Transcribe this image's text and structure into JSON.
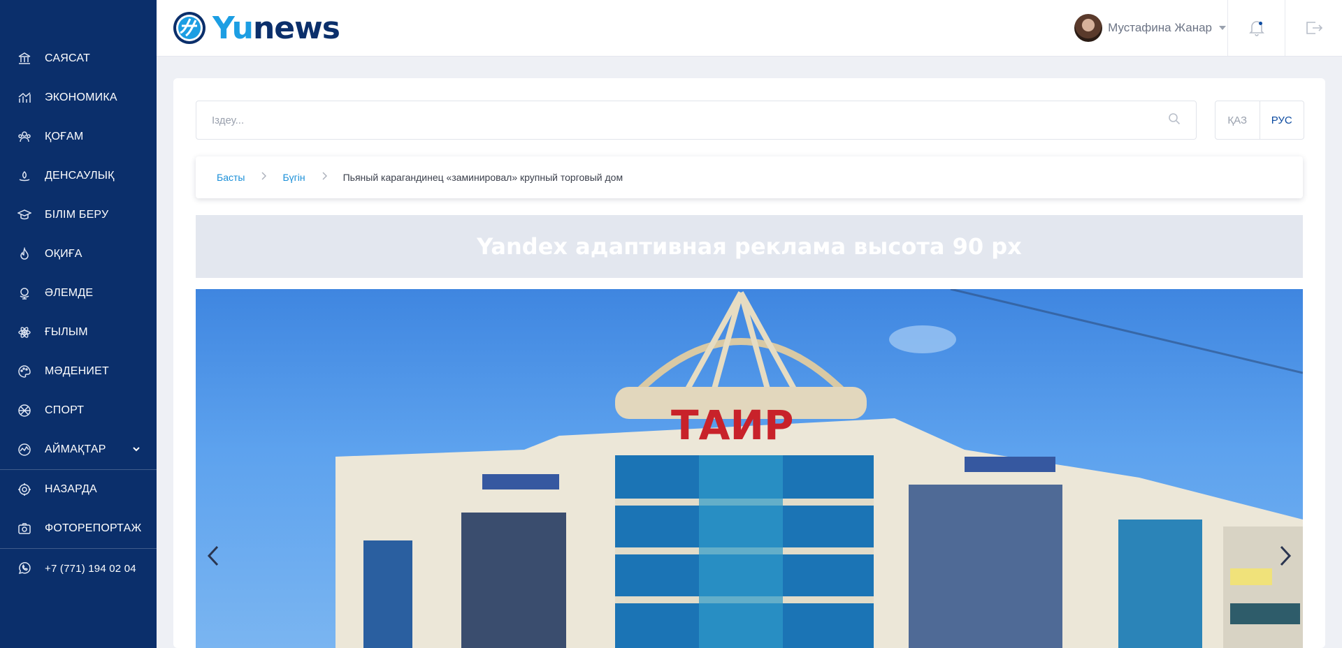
{
  "sidebar": {
    "items": [
      {
        "label": "САЯСАТ",
        "icon": "bank-icon"
      },
      {
        "label": "ЭКОНОМИКА",
        "icon": "bar-chart-icon"
      },
      {
        "label": "ҚОҒАМ",
        "icon": "people-icon"
      },
      {
        "label": "ДЕНСАУЛЫҚ",
        "icon": "health-icon"
      },
      {
        "label": "БІЛІМ БЕРУ",
        "icon": "graduation-cap-icon"
      },
      {
        "label": "ОҚИҒА",
        "icon": "flame-icon"
      },
      {
        "label": "ӘЛЕМДЕ",
        "icon": "globe-icon"
      },
      {
        "label": "ҒЫЛЫМ",
        "icon": "atom-icon"
      },
      {
        "label": "МӘДЕНИЕТ",
        "icon": "palette-icon"
      },
      {
        "label": "СПОРТ",
        "icon": "ball-icon"
      },
      {
        "label": "АЙМАҚТАР",
        "icon": "region-icon"
      }
    ],
    "extra_items": [
      {
        "label": "НАЗАРДА",
        "icon": "target-icon"
      },
      {
        "label": "ФОТОРЕПОРТАЖ",
        "icon": "camera-icon"
      }
    ],
    "phone": "+7 (771) 194 02 04"
  },
  "header": {
    "logo_part1": "Yu",
    "logo_part2": "news",
    "user_name": "Мустафина Жанар"
  },
  "search": {
    "placeholder": "Іздеу..."
  },
  "language": {
    "kaz": "ҚАЗ",
    "rus": "РУС",
    "active": "РУС"
  },
  "breadcrumb": {
    "home": "Басты",
    "section": "Бүгін",
    "current": "Пьяный карагандинец «заминировал» крупный торговый дом"
  },
  "ad": {
    "text": "Yandex адаптивная реклама высота 90 px"
  },
  "slider": {
    "image_text": "ТАИР"
  },
  "colors": {
    "sidebar": "#0b2f6b",
    "accent": "#1c9ee3",
    "link": "#1a8fd8"
  }
}
